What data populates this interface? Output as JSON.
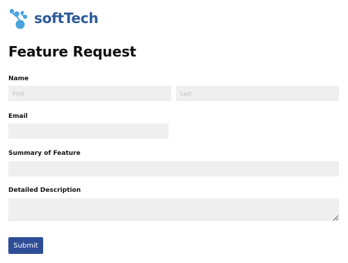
{
  "brand": {
    "logo_text": "softTech",
    "logo_icon": "tech-bubbles-logo-icon",
    "color": "#2d5a9a",
    "icon_color": "#4aa3df"
  },
  "form": {
    "title": "Feature Request",
    "name": {
      "label": "Name",
      "first_placeholder": "First",
      "last_placeholder": "Last",
      "first_value": "",
      "last_value": ""
    },
    "email": {
      "label": "Email",
      "value": ""
    },
    "summary": {
      "label": "Summary of Feature",
      "value": ""
    },
    "description": {
      "label": "Detailed Description",
      "value": ""
    },
    "submit_label": "Submit"
  },
  "colors": {
    "field_background": "#efefef",
    "button_background": "#2e4d97",
    "button_text": "#ffffff"
  }
}
